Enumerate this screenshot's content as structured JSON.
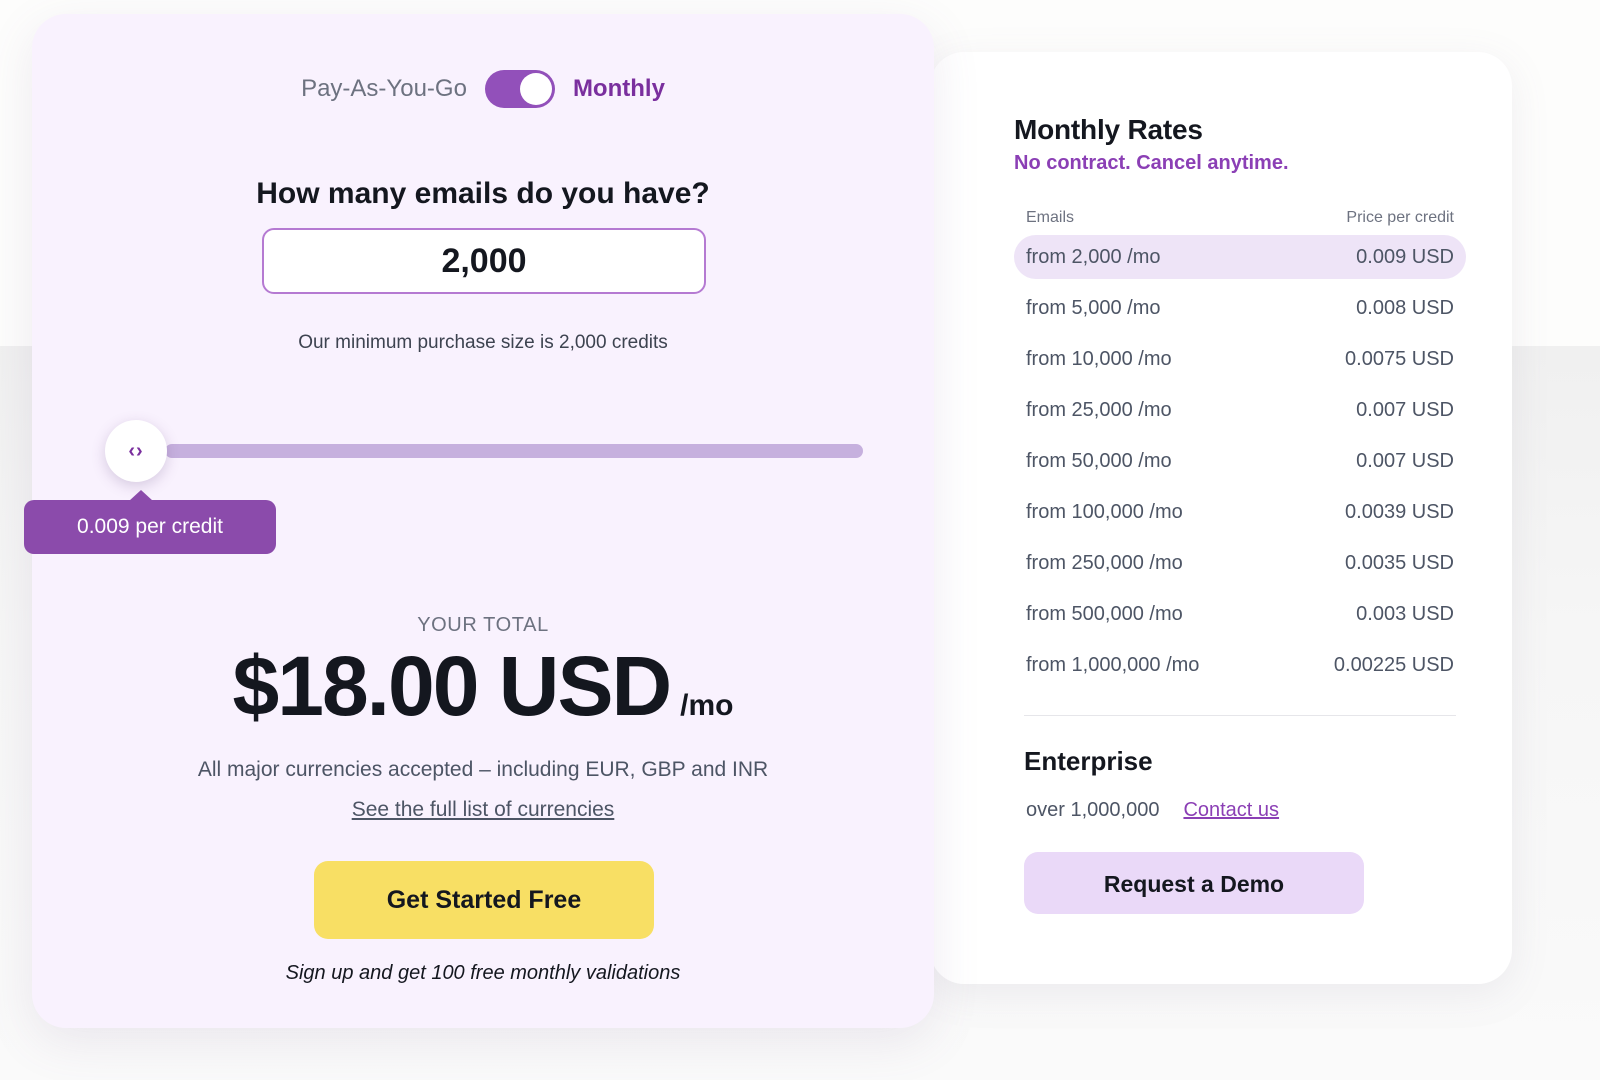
{
  "calculator": {
    "toggle": {
      "left_label": "Pay-As-You-Go",
      "right_label": "Monthly",
      "state": "monthly"
    },
    "question": "How many emails do you have?",
    "email_count_value": "2,000",
    "email_count_placeholder": "2,000",
    "minimum_note": "Our minimum purchase size is 2,000 credits",
    "slider": {
      "tooltip": "0.009 per credit",
      "handle_icon": "left-right-chevron-icon",
      "position_percent": 0
    },
    "total_label": "YOUR TOTAL",
    "total_amount": "$18.00 USD",
    "total_period": "/mo",
    "currency_note": "All major currencies accepted – including EUR, GBP and INR",
    "currency_link": "See the full list of currencies",
    "cta_label": "Get Started Free",
    "signup_note": "Sign up and get 100 free monthly validations"
  },
  "rates": {
    "title": "Monthly Rates",
    "subtitle": "No contract. Cancel anytime.",
    "columns": [
      "Emails",
      "Price per credit"
    ],
    "rows": [
      {
        "tier": "from 2,000 /mo",
        "price": "0.009 USD",
        "active": true
      },
      {
        "tier": "from 5,000 /mo",
        "price": "0.008 USD",
        "active": false
      },
      {
        "tier": "from 10,000 /mo",
        "price": "0.0075 USD",
        "active": false
      },
      {
        "tier": "from 25,000 /mo",
        "price": "0.007 USD",
        "active": false
      },
      {
        "tier": "from 50,000 /mo",
        "price": "0.007 USD",
        "active": false
      },
      {
        "tier": "from 100,000 /mo",
        "price": "0.0039 USD",
        "active": false
      },
      {
        "tier": "from 250,000 /mo",
        "price": "0.0035 USD",
        "active": false
      },
      {
        "tier": "from 500,000 /mo",
        "price": "0.003 USD",
        "active": false
      },
      {
        "tier": "from 1,000,000 /mo",
        "price": "0.00225 USD",
        "active": false
      }
    ],
    "enterprise": {
      "title": "Enterprise",
      "volume": "over 1,000,000",
      "contact_link": "Contact us",
      "demo_button": "Request a Demo"
    }
  },
  "colors": {
    "accent_purple": "#8b3fb5",
    "toggle_on": "#9250ba",
    "tooltip_purple": "#8b4bab",
    "slider_track": "#c6b0de",
    "cta_yellow": "#f8df64",
    "demo_lavender": "#ead9f8",
    "card_lavender": "#f9f2fe",
    "row_highlight": "#eee4f7"
  }
}
